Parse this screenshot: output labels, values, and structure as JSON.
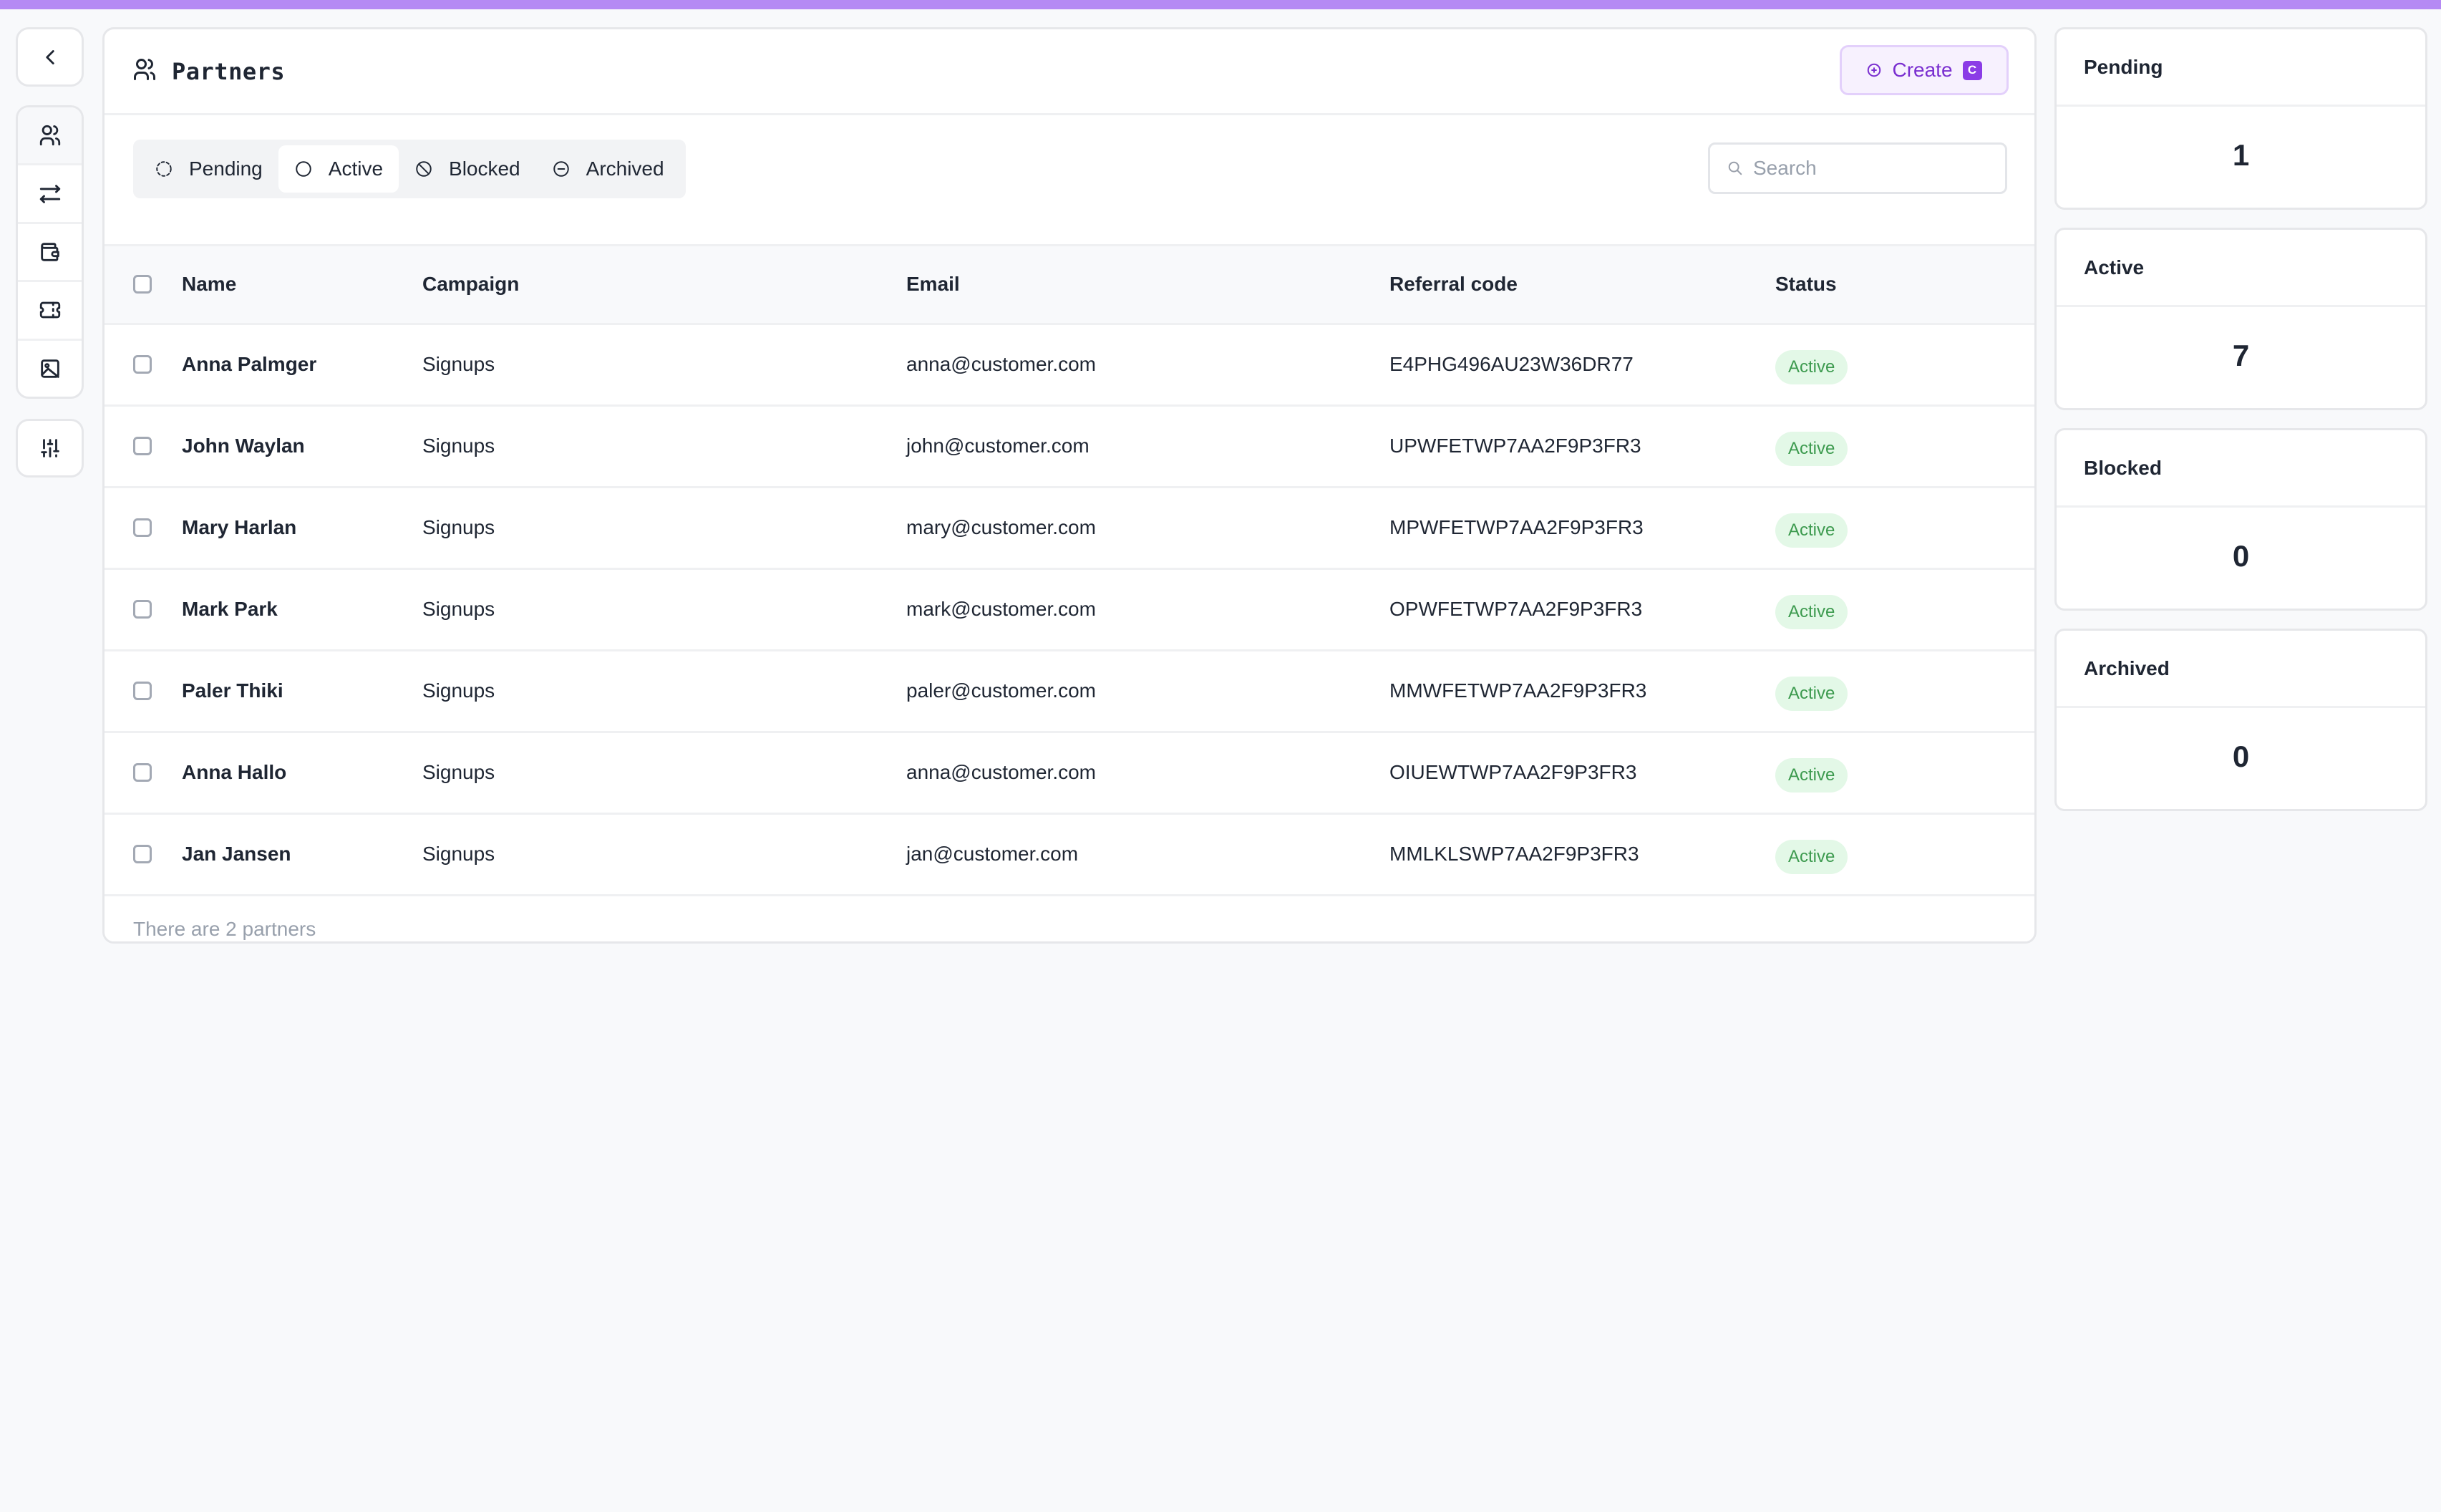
{
  "colors": {
    "accent_bar": "#b58af4",
    "primary": "#7a2fd0",
    "badge_active_bg": "#e3f8e7",
    "badge_active_text": "#3c9a4e"
  },
  "nav": {
    "back_icon": "chevron-left-icon",
    "items": [
      {
        "icon": "users-icon",
        "label": "Partners",
        "selected": true
      },
      {
        "icon": "arrows-left-right-icon",
        "label": "Transactions",
        "selected": false
      },
      {
        "icon": "wallet-icon",
        "label": "Payouts",
        "selected": false
      },
      {
        "icon": "ticket-icon",
        "label": "Coupons",
        "selected": false
      },
      {
        "icon": "image-icon",
        "label": "Assets",
        "selected": false
      }
    ],
    "settings_icon": "adjustments-icon"
  },
  "header": {
    "title": "Partners",
    "icon": "users-icon",
    "create_label": "Create",
    "create_shortcut": "C"
  },
  "tabs": [
    {
      "label": "Pending",
      "icon": "dashed-circle-icon",
      "selected": false
    },
    {
      "label": "Active",
      "icon": "circle-icon",
      "selected": true
    },
    {
      "label": "Blocked",
      "icon": "ban-icon",
      "selected": false
    },
    {
      "label": "Archived",
      "icon": "circle-minus-icon",
      "selected": false
    }
  ],
  "search": {
    "placeholder": "Search",
    "value": ""
  },
  "table": {
    "columns": [
      "Name",
      "Campaign",
      "Email",
      "Referral code",
      "Status"
    ],
    "rows": [
      {
        "name": "Anna Palmger",
        "campaign": "Signups",
        "email": "anna@customer.com",
        "referral_code": "E4PHG496AU23W36DR77",
        "status": "Active"
      },
      {
        "name": "John Waylan",
        "campaign": "Signups",
        "email": "john@customer.com",
        "referral_code": "UPWFETWP7AA2F9P3FR3",
        "status": "Active"
      },
      {
        "name": "Mary Harlan",
        "campaign": "Signups",
        "email": "mary@customer.com",
        "referral_code": "MPWFETWP7AA2F9P3FR3",
        "status": "Active"
      },
      {
        "name": "Mark Park",
        "campaign": "Signups",
        "email": "mark@customer.com",
        "referral_code": "OPWFETWP7AA2F9P3FR3",
        "status": "Active"
      },
      {
        "name": "Paler Thiki",
        "campaign": "Signups",
        "email": "paler@customer.com",
        "referral_code": "MMWFETWP7AA2F9P3FR3",
        "status": "Active"
      },
      {
        "name": "Anna Hallo",
        "campaign": "Signups",
        "email": "anna@customer.com",
        "referral_code": "OIUEWTWP7AA2F9P3FR3",
        "status": "Active"
      },
      {
        "name": "Jan Jansen",
        "campaign": "Signups",
        "email": "jan@customer.com",
        "referral_code": "MMLKLSWP7AA2F9P3FR3",
        "status": "Active"
      }
    ],
    "footer": "There are 2 partners"
  },
  "stats": [
    {
      "label": "Pending",
      "value": "1"
    },
    {
      "label": "Active",
      "value": "7"
    },
    {
      "label": "Blocked",
      "value": "0"
    },
    {
      "label": "Archived",
      "value": "0"
    }
  ]
}
